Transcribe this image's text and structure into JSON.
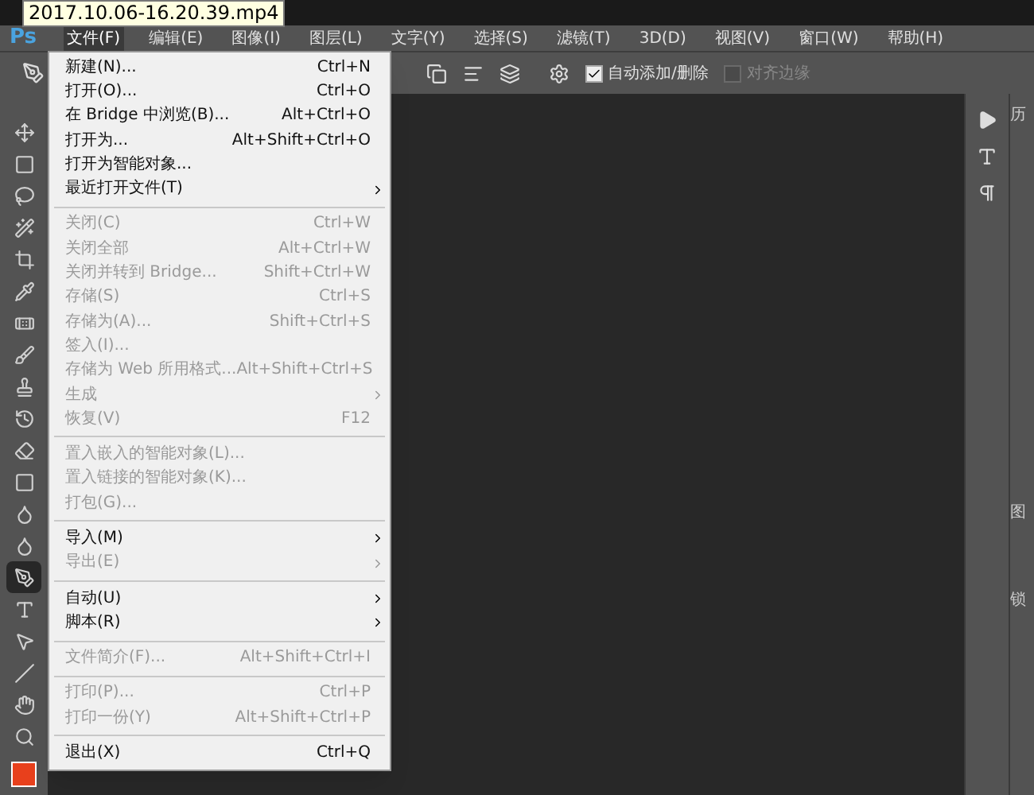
{
  "tooltip": "2017.10.06-16.20.39.mp4",
  "app_logo": "Ps",
  "menubar": [
    {
      "label": "文件(F)",
      "selected": true
    },
    {
      "label": "编辑(E)",
      "selected": false
    },
    {
      "label": "图像(I)",
      "selected": false
    },
    {
      "label": "图层(L)",
      "selected": false
    },
    {
      "label": "文字(Y)",
      "selected": false
    },
    {
      "label": "选择(S)",
      "selected": false
    },
    {
      "label": "滤镜(T)",
      "selected": false
    },
    {
      "label": "3D(D)",
      "selected": false
    },
    {
      "label": "视图(V)",
      "selected": false
    },
    {
      "label": "窗口(W)",
      "selected": false
    },
    {
      "label": "帮助(H)",
      "selected": false
    }
  ],
  "options_bar": {
    "checkboxes": [
      {
        "label": "自动添加/删除",
        "checked": true,
        "disabled": false
      },
      {
        "label": "对齐边缘",
        "checked": false,
        "disabled": true
      }
    ]
  },
  "file_menu": [
    {
      "kind": "item",
      "label": "新建(N)...",
      "shortcut": "Ctrl+N",
      "disabled": false,
      "submenu": false
    },
    {
      "kind": "item",
      "label": "打开(O)...",
      "shortcut": "Ctrl+O",
      "disabled": false,
      "submenu": false
    },
    {
      "kind": "item",
      "label": "在 Bridge 中浏览(B)...",
      "shortcut": "Alt+Ctrl+O",
      "disabled": false,
      "submenu": false
    },
    {
      "kind": "item",
      "label": "打开为...",
      "shortcut": "Alt+Shift+Ctrl+O",
      "disabled": false,
      "submenu": false
    },
    {
      "kind": "item",
      "label": "打开为智能对象...",
      "disabled": false,
      "submenu": false
    },
    {
      "kind": "item",
      "label": "最近打开文件(T)",
      "disabled": false,
      "submenu": true
    },
    {
      "kind": "separator"
    },
    {
      "kind": "item",
      "label": "关闭(C)",
      "shortcut": "Ctrl+W",
      "disabled": true,
      "submenu": false
    },
    {
      "kind": "item",
      "label": "关闭全部",
      "shortcut": "Alt+Ctrl+W",
      "disabled": true,
      "submenu": false
    },
    {
      "kind": "item",
      "label": "关闭并转到 Bridge...",
      "shortcut": "Shift+Ctrl+W",
      "disabled": true,
      "submenu": false
    },
    {
      "kind": "item",
      "label": "存储(S)",
      "shortcut": "Ctrl+S",
      "disabled": true,
      "submenu": false
    },
    {
      "kind": "item",
      "label": "存储为(A)...",
      "shortcut": "Shift+Ctrl+S",
      "disabled": true,
      "submenu": false
    },
    {
      "kind": "item",
      "label": "签入(I)...",
      "disabled": true,
      "submenu": false
    },
    {
      "kind": "item",
      "label": "存储为 Web 所用格式...",
      "shortcut": "Alt+Shift+Ctrl+S",
      "disabled": true,
      "submenu": false
    },
    {
      "kind": "item",
      "label": "生成",
      "disabled": true,
      "submenu": true
    },
    {
      "kind": "item",
      "label": "恢复(V)",
      "shortcut": "F12",
      "disabled": true,
      "submenu": false
    },
    {
      "kind": "separator"
    },
    {
      "kind": "item",
      "label": "置入嵌入的智能对象(L)...",
      "disabled": true,
      "submenu": false
    },
    {
      "kind": "item",
      "label": "置入链接的智能对象(K)...",
      "disabled": true,
      "submenu": false
    },
    {
      "kind": "item",
      "label": "打包(G)...",
      "disabled": true,
      "submenu": false
    },
    {
      "kind": "separator"
    },
    {
      "kind": "item",
      "label": "导入(M)",
      "disabled": false,
      "submenu": true
    },
    {
      "kind": "item",
      "label": "导出(E)",
      "disabled": true,
      "submenu": true
    },
    {
      "kind": "separator"
    },
    {
      "kind": "item",
      "label": "自动(U)",
      "disabled": false,
      "submenu": true
    },
    {
      "kind": "item",
      "label": "脚本(R)",
      "disabled": false,
      "submenu": true
    },
    {
      "kind": "separator"
    },
    {
      "kind": "item",
      "label": "文件简介(F)...",
      "shortcut": "Alt+Shift+Ctrl+I",
      "disabled": true,
      "submenu": false
    },
    {
      "kind": "separator"
    },
    {
      "kind": "item",
      "label": "打印(P)...",
      "shortcut": "Ctrl+P",
      "disabled": true,
      "submenu": false
    },
    {
      "kind": "item",
      "label": "打印一份(Y)",
      "shortcut": "Alt+Shift+Ctrl+P",
      "disabled": true,
      "submenu": false
    },
    {
      "kind": "separator"
    },
    {
      "kind": "item",
      "label": "退出(X)",
      "shortcut": "Ctrl+Q",
      "disabled": false,
      "submenu": false
    }
  ],
  "right_panel": {
    "tabs": [
      "历",
      "图",
      "锁"
    ]
  }
}
